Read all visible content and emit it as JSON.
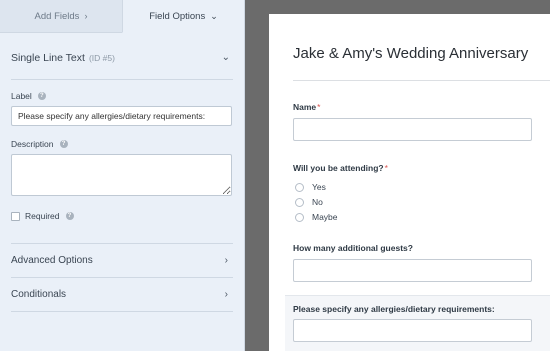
{
  "tabs": [
    {
      "label": "Add Fields",
      "chevron": "›"
    },
    {
      "label": "Field Options",
      "chevron": "⌄"
    }
  ],
  "field_options": {
    "section_title": "Single Line Text",
    "field_id": "(ID #5)",
    "label_caption": "Label",
    "label_value": "Please specify any allergies/dietary requirements:",
    "description_caption": "Description",
    "required_caption": "Required",
    "advanced_options": "Advanced Options",
    "conditionals": "Conditionals"
  },
  "form": {
    "title": "Jake & Amy's Wedding Anniversary",
    "fields": [
      {
        "label": "Name",
        "required_mark": "*"
      },
      {
        "label": "Will you be attending?",
        "required_mark": "*"
      },
      {
        "label": "How many additional guests?"
      },
      {
        "label": "Please specify any allergies/dietary requirements:"
      }
    ],
    "attending_options": [
      "Yes",
      "No",
      "Maybe"
    ]
  },
  "icons": {
    "help": "question-circle-icon",
    "collapse": "chevron-down-icon",
    "expand": "chevron-right-icon"
  },
  "colors": {
    "sidebar_bg": "#eaf0f8",
    "canvas_bg": "#6b6b6b",
    "required_star": "#d9534f"
  }
}
